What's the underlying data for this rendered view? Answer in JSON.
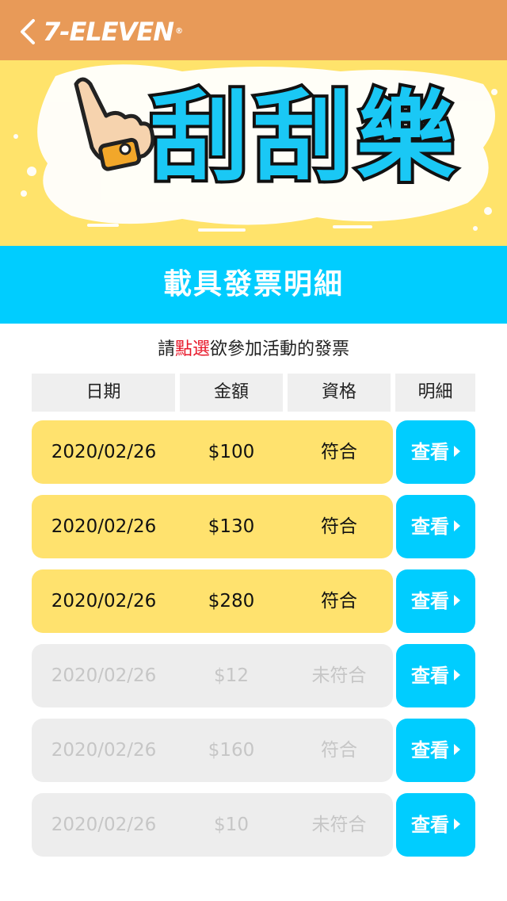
{
  "header": {
    "brand": "7-ELEVEN",
    "brand_mark": "®",
    "back_icon": "chevron-left-icon",
    "color": "#E89A58"
  },
  "banner": {
    "title": "刮刮樂",
    "title_color": "#1AC8F5",
    "background": "#FFE36B",
    "icon": "pointing-hand-icon"
  },
  "section": {
    "title": "載具發票明細",
    "color": "#00CDFF"
  },
  "instruction": {
    "pre": "請",
    "highlight": "點選",
    "post": "欲參加活動的發票",
    "highlight_color": "#E8182A"
  },
  "table": {
    "headers": [
      "日期",
      "金額",
      "資格",
      "明細"
    ],
    "rows": [
      {
        "date": "2020/02/26",
        "amount": "$100",
        "eligibility": "符合",
        "action": "查看",
        "state": "active"
      },
      {
        "date": "2020/02/26",
        "amount": "$130",
        "eligibility": "符合",
        "action": "查看",
        "state": "active"
      },
      {
        "date": "2020/02/26",
        "amount": "$280",
        "eligibility": "符合",
        "action": "查看",
        "state": "active"
      },
      {
        "date": "2020/02/26",
        "amount": "$12",
        "eligibility": "未符合",
        "action": "查看",
        "state": "disabled"
      },
      {
        "date": "2020/02/26",
        "amount": "$160",
        "eligibility": "符合",
        "action": "查看",
        "state": "disabled"
      },
      {
        "date": "2020/02/26",
        "amount": "$10",
        "eligibility": "未符合",
        "action": "查看",
        "state": "disabled"
      }
    ]
  }
}
